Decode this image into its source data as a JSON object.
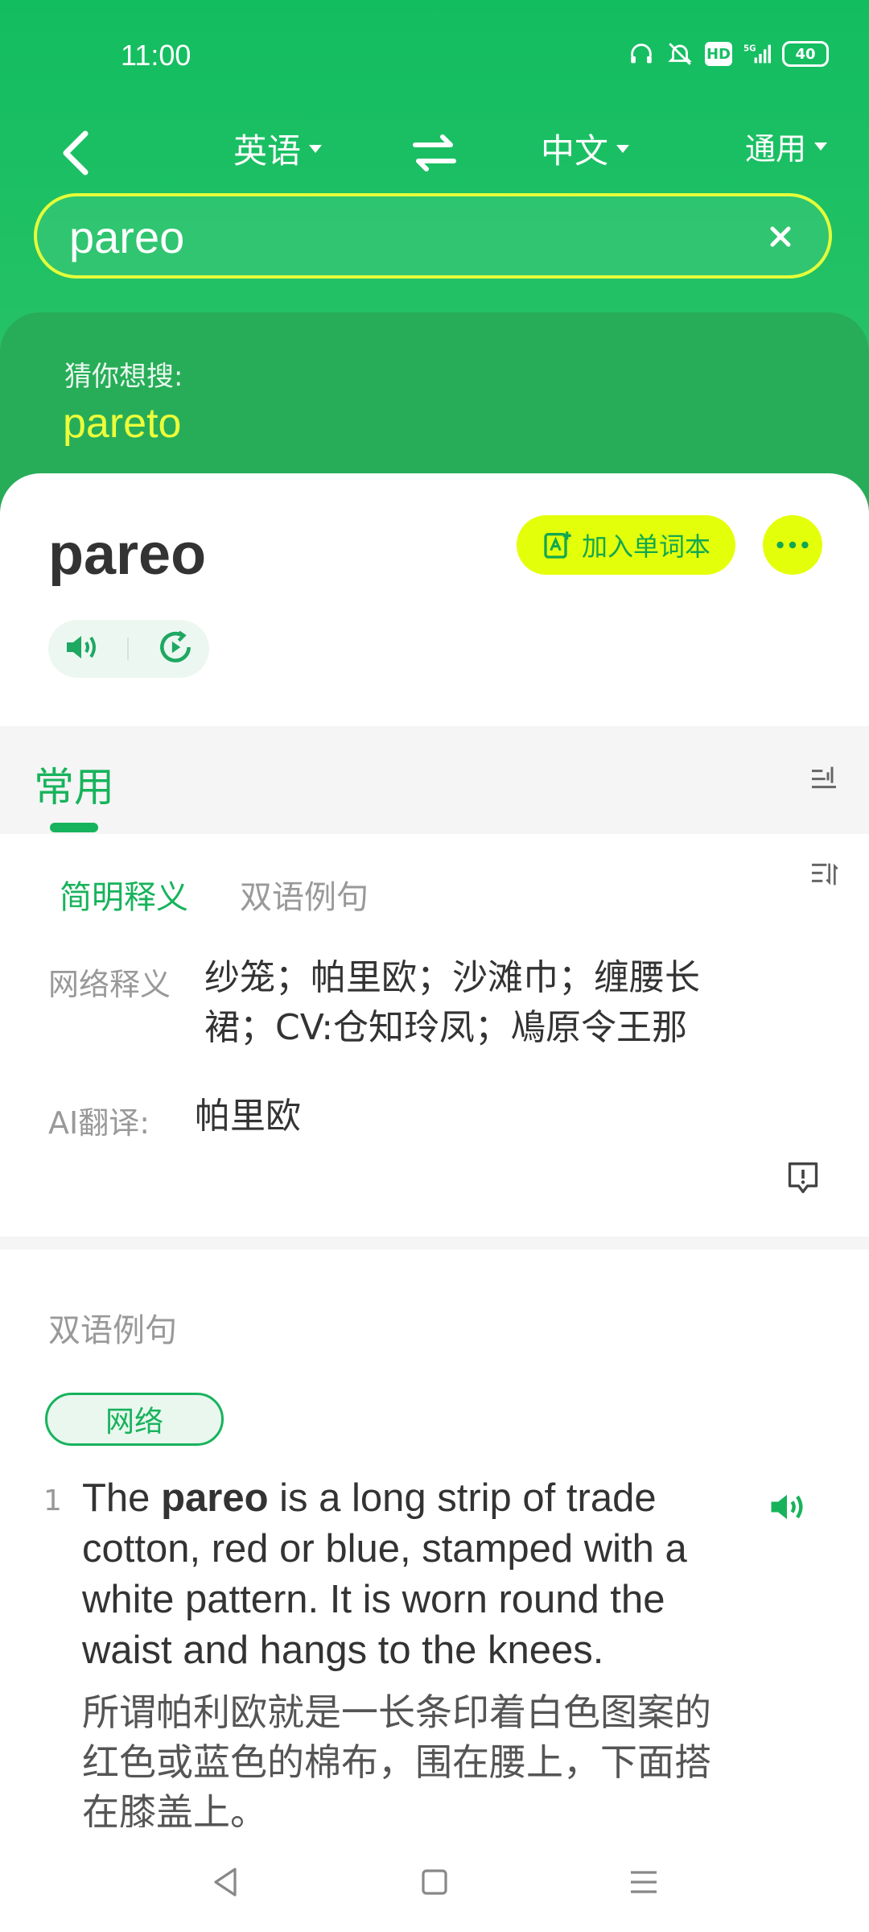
{
  "status_bar": {
    "time": "11:00",
    "icons": [
      "headphones-icon",
      "bell-muted-icon",
      "hd-icon",
      "signal-5g-icon",
      "battery-icon"
    ],
    "hd_label": "HD",
    "network": "5G",
    "battery": "40"
  },
  "nav": {
    "source_lang": "英语",
    "target_lang": "中文",
    "mode": "通用"
  },
  "search": {
    "value": "pareo"
  },
  "suggestion": {
    "label": "猜你想搜:",
    "word": "pareto"
  },
  "entry": {
    "headword": "pareo",
    "add_button": "加入单词本"
  },
  "tabs": {
    "active": "常用"
  },
  "definitions": {
    "subtabs": [
      "简明释义",
      "双语例句"
    ],
    "web_label": "网络释义",
    "web_line1": "纱笼；帕里欧；沙滩巾；缠腰长",
    "web_line2": "裙；CV:仓知玲凤；鳰原令王那",
    "ai_label": "AI翻译:",
    "ai_text": "帕里欧"
  },
  "examples": {
    "title": "双语例句",
    "tag": "网络",
    "items": [
      {
        "num": "1",
        "en_before": "The ",
        "en_bold": "pareo",
        "en_after": " is a long strip of trade cotton, red or blue, stamped with a white pattern. It is worn round the waist and hangs to the knees.",
        "zh": "所谓帕利欧就是一长条印着白色图案的红色或蓝色的棉布，围在腰上，下面搭在膝盖上。"
      }
    ]
  },
  "colors": {
    "brand_green": "#17b35c",
    "accent_yellow": "#e4ff0a",
    "header_green": "#12bd60"
  }
}
